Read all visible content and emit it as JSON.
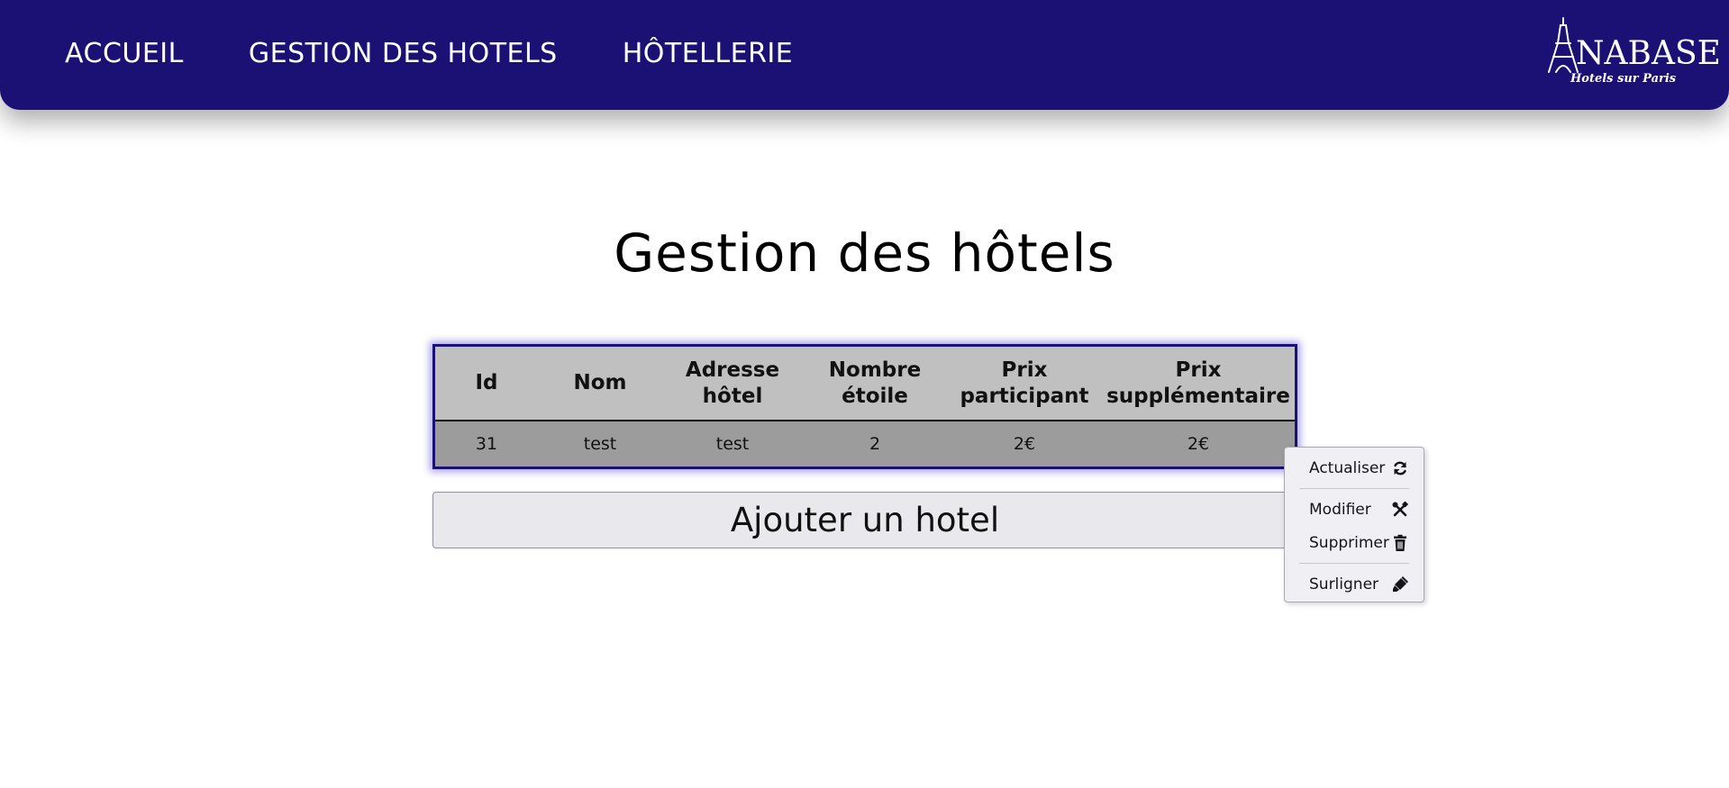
{
  "nav": {
    "links": [
      "ACCUEIL",
      "GESTION DES HOTELS",
      "HÔTELLERIE"
    ],
    "logo": {
      "word": "NABASE",
      "subtitle": "Hotels sur Paris",
      "icon": "eiffel-tower-icon"
    }
  },
  "page": {
    "title": "Gestion des hôtels"
  },
  "table": {
    "headers": [
      "Id",
      "Nom",
      "Adresse hôtel",
      "Nombre étoile",
      "Prix participant",
      "Prix supplémentaire"
    ],
    "rows": [
      [
        "31",
        "test",
        "test",
        "2",
        "2€",
        "2€"
      ]
    ]
  },
  "add_button": {
    "label": "Ajouter un hotel"
  },
  "context_menu": {
    "items": [
      {
        "label": "Actualiser",
        "icon": "refresh-icon"
      },
      {
        "label": "Modifier",
        "icon": "tools-icon"
      },
      {
        "label": "Supprimer",
        "icon": "trash-icon"
      },
      {
        "label": "Surligner",
        "icon": "highlighter-icon"
      }
    ]
  },
  "colors": {
    "nav_bg": "#1b1073",
    "table_header_bg": "#c0c0c0",
    "table_row_bg": "#9c9c9c",
    "table_border": "#1b1073"
  }
}
